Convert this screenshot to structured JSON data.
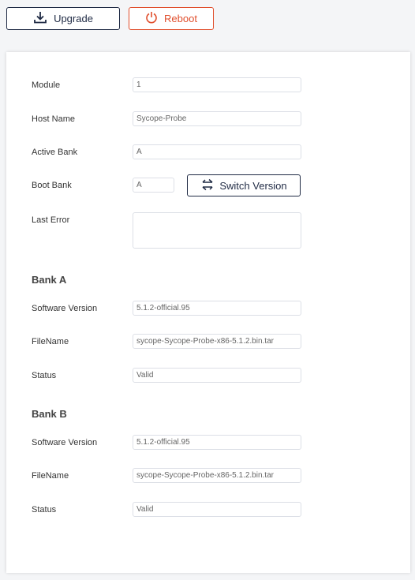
{
  "toolbar": {
    "upgrade_label": "Upgrade",
    "reboot_label": "Reboot",
    "upgrade_icon": "download-icon",
    "reboot_icon": "power-icon"
  },
  "colors": {
    "primary": "#1f2a44",
    "danger": "#e04e2c",
    "background": "#f4f5f7"
  },
  "general": {
    "module_label": "Module",
    "module_value": "1",
    "hostname_label": "Host Name",
    "hostname_value": "Sycope-Probe",
    "active_bank_label": "Active Bank",
    "active_bank_value": "A",
    "boot_bank_label": "Boot Bank",
    "boot_bank_value": "A",
    "switch_version_label": "Switch Version",
    "switch_icon": "switch-arrows-icon",
    "last_error_label": "Last Error",
    "last_error_value": ""
  },
  "bank_a": {
    "title": "Bank A",
    "software_version_label": "Software Version",
    "software_version_value": "5.1.2-official.95",
    "filename_label": "FileName",
    "filename_value": "sycope-Sycope-Probe-x86-5.1.2.bin.tar",
    "status_label": "Status",
    "status_value": "Valid"
  },
  "bank_b": {
    "title": "Bank B",
    "software_version_label": "Software Version",
    "software_version_value": "5.1.2-official.95",
    "filename_label": "FileName",
    "filename_value": "sycope-Sycope-Probe-x86-5.1.2.bin.tar",
    "status_label": "Status",
    "status_value": "Valid"
  }
}
